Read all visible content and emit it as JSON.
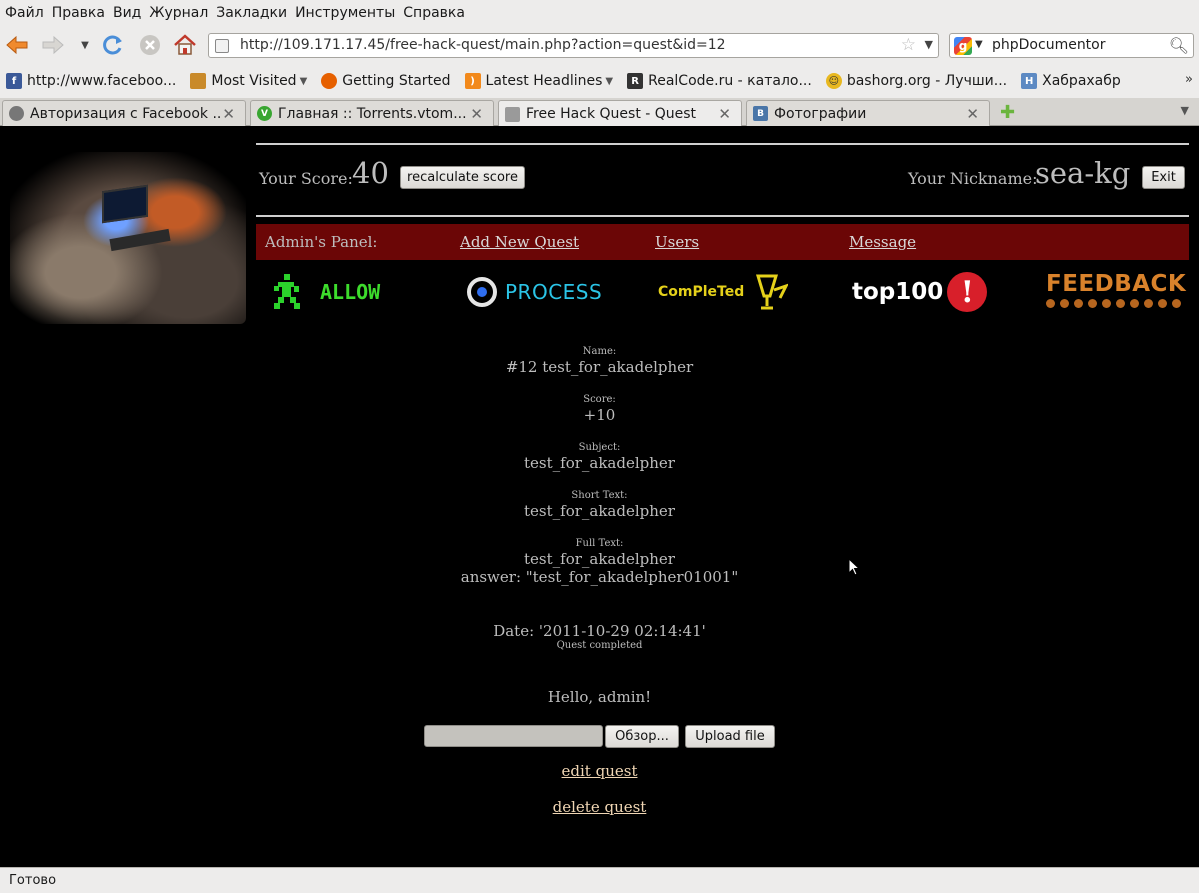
{
  "menu": [
    "Файл",
    "Правка",
    "Вид",
    "Журнал",
    "Закладки",
    "Инструменты",
    "Справка"
  ],
  "nav": {
    "url": "http://109.171.17.45/free-hack-quest/main.php?action=quest&id=12",
    "search": "phpDocumentor"
  },
  "bookmarks": [
    {
      "label": "http://www.faceboo...",
      "icon": "facebook-icon",
      "color": "#3b5998"
    },
    {
      "label": "Most Visited",
      "icon": "most-visited-icon",
      "color": "#c98a2a",
      "dropdown": true
    },
    {
      "label": "Getting Started",
      "icon": "firefox-icon",
      "color": "#e66000"
    },
    {
      "label": "Latest Headlines",
      "icon": "rss-icon",
      "color": "#f2891b",
      "dropdown": true
    },
    {
      "label": "RealCode.ru - катало...",
      "icon": "realcode-icon",
      "color": "#333333"
    },
    {
      "label": "bashorg.org - Лучши...",
      "icon": "smiley-icon",
      "color": "#e8b820"
    },
    {
      "label": "Хабрахабр",
      "icon": "habr-icon",
      "color": "#5d8ac3"
    }
  ],
  "tabs": [
    {
      "label": "Авторизация с Facebook ...",
      "icon": "facebook-auth-icon",
      "color": "#777777",
      "active": false
    },
    {
      "label": "Главная :: Torrents.vtom...",
      "icon": "torrents-icon",
      "color": "#39a631",
      "active": false
    },
    {
      "label": "Free Hack Quest - Quest",
      "icon": "page-icon",
      "color": "#9a9a9a",
      "active": true
    },
    {
      "label": "Фотографии",
      "icon": "vk-icon",
      "color": "#4a76a8",
      "active": false
    }
  ],
  "header": {
    "score_label": "Your Score:",
    "score_value": "40",
    "recalc_label": "recalculate score",
    "nick_label": "Your Nickname:",
    "nick_value": "sea-kg",
    "exit_label": "Exit"
  },
  "admin": {
    "label": "Admin's Panel:",
    "links": [
      "Add New Quest",
      "Users",
      "Message"
    ]
  },
  "logos": {
    "allow": "ALLOW",
    "process": "PROCESS",
    "completed": "ComPleTed",
    "top100": "top100",
    "feedback": "FEEDBACK"
  },
  "quest": {
    "name_label": "Name:",
    "name": "#12 test_for_akadelpher",
    "score_label": "Score:",
    "score": "+10",
    "subject_label": "Subject:",
    "subject": "test_for_akadelpher",
    "short_label": "Short Text:",
    "short_text": "test_for_akadelpher",
    "full_label": "Full Text:",
    "full_text": "test_for_akadelpher",
    "answer": "answer: \"test_for_akadelpher01001\"",
    "date": "Date: '2011-10-29 02:14:41'",
    "status": "Quest completed",
    "hello": "Hello, admin!",
    "browse_label": "Обзор...",
    "upload_label": "Upload file",
    "edit_label": "edit quest",
    "delete_label": "delete quest"
  },
  "status": "Готово"
}
